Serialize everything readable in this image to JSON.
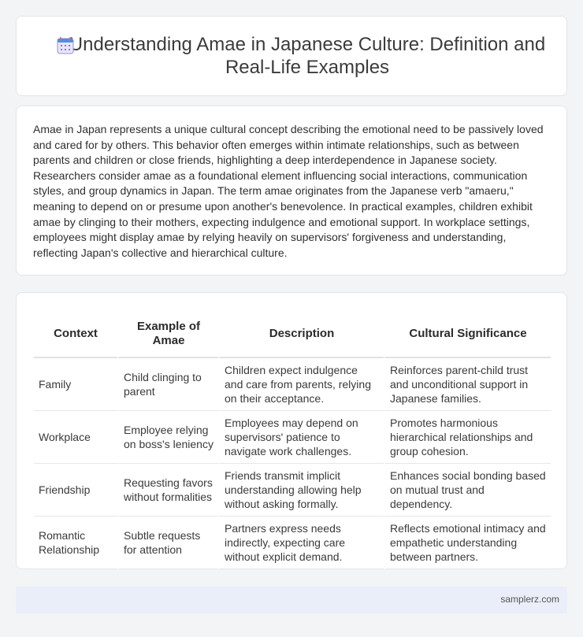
{
  "header": {
    "icon": "calendar-icon",
    "title": "Understanding Amae in Japanese Culture: Definition and Real-Life Examples"
  },
  "intro": {
    "text": "Amae in Japan represents a unique cultural concept describing the emotional need to be passively loved and cared for by others. This behavior often emerges within intimate relationships, such as between parents and children or close friends, highlighting a deep interdependence in Japanese society. Researchers consider amae as a foundational element influencing social interactions, communication styles, and group dynamics in Japan. The term amae originates from the Japanese verb \"amaeru,\" meaning to depend on or presume upon another's benevolence. In practical examples, children exhibit amae by clinging to their mothers, expecting indulgence and emotional support. In workplace settings, employees might display amae by relying heavily on supervisors' forgiveness and understanding, reflecting Japan's collective and hierarchical culture."
  },
  "table": {
    "headers": [
      "Context",
      "Example of Amae",
      "Description",
      "Cultural Significance"
    ],
    "rows": [
      [
        "Family",
        "Child clinging to parent",
        "Children expect indulgence and care from parents, relying on their acceptance.",
        "Reinforces parent-child trust and unconditional support in Japanese families."
      ],
      [
        "Workplace",
        "Employee relying on boss's leniency",
        "Employees may depend on supervisors' patience to navigate work challenges.",
        "Promotes harmonious hierarchical relationships and group cohesion."
      ],
      [
        "Friendship",
        "Requesting favors without formalities",
        "Friends transmit implicit understanding allowing help without asking formally.",
        "Enhances social bonding based on mutual trust and dependency."
      ],
      [
        "Romantic Relationship",
        "Subtle requests for attention",
        "Partners express needs indirectly, expecting care without explicit demand.",
        "Reflects emotional intimacy and empathetic understanding between partners."
      ]
    ]
  },
  "footer": {
    "text": "samplerz.com"
  },
  "colors": {
    "background": "#f3f4f6",
    "card": "#ffffff",
    "footer": "#e9eef8"
  }
}
